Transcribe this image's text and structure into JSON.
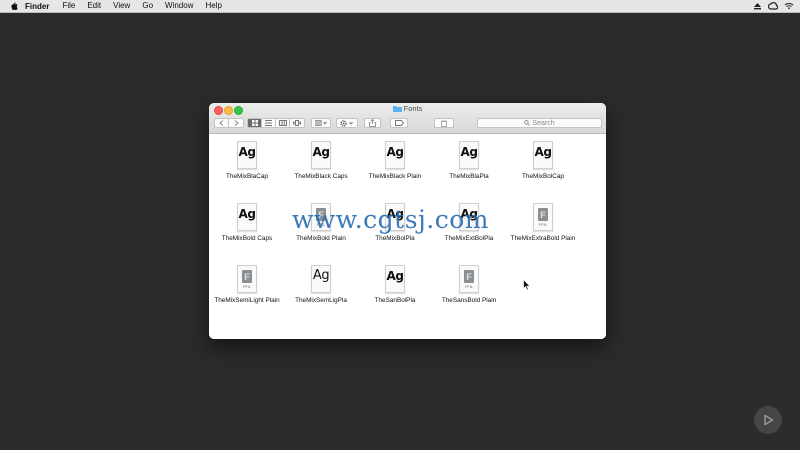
{
  "menubar": {
    "app_name": "Finder",
    "items": [
      "File",
      "Edit",
      "View",
      "Go",
      "Window",
      "Help"
    ]
  },
  "window": {
    "title": "Fonts",
    "search_placeholder": "Search"
  },
  "files": [
    {
      "name": "TheMixBlaCap",
      "icon": "ag-bold"
    },
    {
      "name": "TheMixBlack Caps",
      "icon": "ag-bold"
    },
    {
      "name": "TheMixBlack Plain",
      "icon": "ag-bold"
    },
    {
      "name": "TheMixBlaPla",
      "icon": "ag-bold"
    },
    {
      "name": "TheMixBolCap",
      "icon": "ag-bold"
    },
    {
      "name": "TheMixBold Caps",
      "icon": "ag-bold"
    },
    {
      "name": "TheMixBold Plain",
      "icon": "ffil"
    },
    {
      "name": "TheMixBolPla",
      "icon": "ag-bold"
    },
    {
      "name": "TheMixExtBolPla",
      "icon": "ag-bold"
    },
    {
      "name": "TheMixExtraBold Plain",
      "icon": "ffil"
    },
    {
      "name": "TheMixSemiLight Plain",
      "icon": "ffil"
    },
    {
      "name": "TheMixSemLigPla",
      "icon": "ag-light"
    },
    {
      "name": "TheSanBolPla",
      "icon": "ag-bold"
    },
    {
      "name": "TheSansBold Plain",
      "icon": "ffil"
    }
  ],
  "icon_text": {
    "ag": "Ag",
    "ffil": "FFIL"
  },
  "watermark": "www.cgtsj.com",
  "colors": {
    "close": "#fc605b",
    "minimize": "#fdbc40",
    "zoom": "#34c84a",
    "watermark": "#2a6fb5"
  }
}
